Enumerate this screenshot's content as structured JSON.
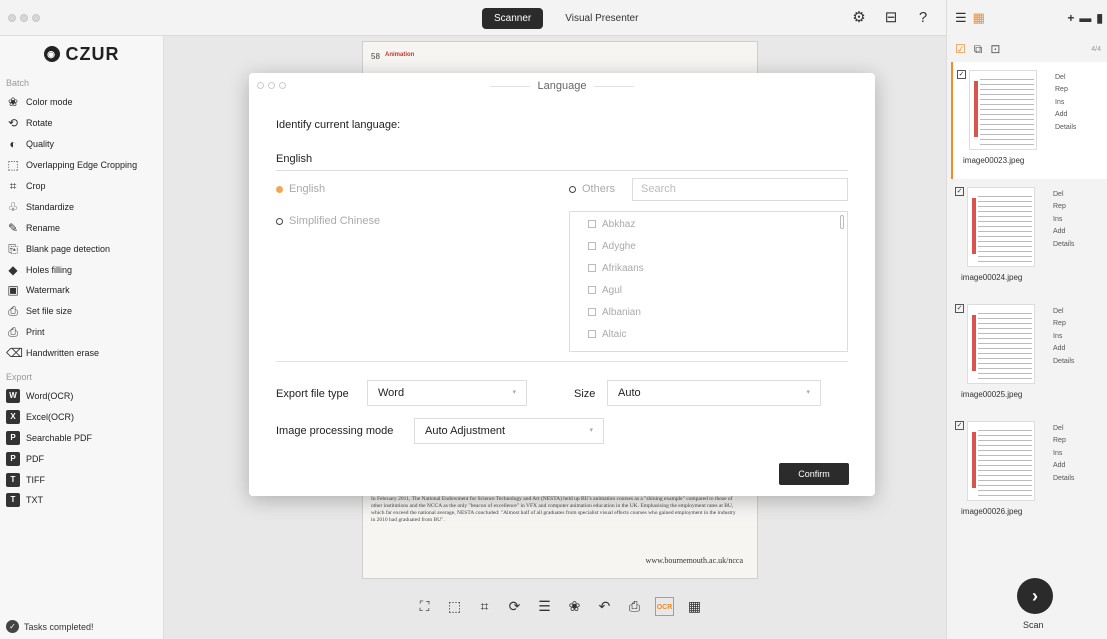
{
  "app": {
    "modes": [
      "Scanner",
      "Visual Presenter"
    ],
    "active_mode": "Scanner",
    "top_icons": [
      "gear-icon",
      "display-icon",
      "help-icon"
    ]
  },
  "sidebar": {
    "logo_text": "CZUR",
    "batch_title": "Batch",
    "batch_items": [
      {
        "label": "Color mode",
        "icon": "color-mode-icon",
        "glyph": "❀"
      },
      {
        "label": "Rotate",
        "icon": "rotate-icon",
        "glyph": "⟲"
      },
      {
        "label": "Quality",
        "icon": "quality-icon",
        "glyph": "◐"
      },
      {
        "label": "Overlapping Edge Cropping",
        "icon": "edge-crop-icon",
        "glyph": "⬚"
      },
      {
        "label": "Crop",
        "icon": "crop-icon",
        "glyph": "⌗"
      },
      {
        "label": "Standardize",
        "icon": "standardize-icon",
        "glyph": "♧"
      },
      {
        "label": "Rename",
        "icon": "rename-icon",
        "glyph": "✎"
      },
      {
        "label": "Blank page detection",
        "icon": "blank-page-icon",
        "glyph": "⎘"
      },
      {
        "label": "Holes filling",
        "icon": "holes-filling-icon",
        "glyph": "◆"
      },
      {
        "label": "Watermark",
        "icon": "watermark-icon",
        "glyph": "▣"
      },
      {
        "label": "Set file size",
        "icon": "file-size-icon",
        "glyph": "⎙"
      },
      {
        "label": "Print",
        "icon": "print-icon",
        "glyph": "⎙"
      },
      {
        "label": "Handwritten erase",
        "icon": "erase-icon",
        "glyph": "⌫"
      }
    ],
    "export_title": "Export",
    "export_items": [
      {
        "label": "Word(OCR)",
        "icon": "word-icon",
        "glyph": "W"
      },
      {
        "label": "Excel(OCR)",
        "icon": "excel-icon",
        "glyph": "X"
      },
      {
        "label": "Searchable PDF",
        "icon": "searchable-pdf-icon",
        "glyph": "P"
      },
      {
        "label": "PDF",
        "icon": "pdf-icon",
        "glyph": "P"
      },
      {
        "label": "TIFF",
        "icon": "tiff-icon",
        "glyph": "T"
      },
      {
        "label": "TXT",
        "icon": "txt-icon",
        "glyph": "T"
      }
    ],
    "status": "Tasks completed!"
  },
  "document": {
    "page_number": "58",
    "heading": "Animation",
    "body_text": "In February 2011, The National Endowment for Science Technology and Art (NESTA) held up BU's animation courses as a \"shining example\" compared to those of other institutions and the NCCA as the only \"beacon of excellence\" in VFX and computer animation education in the UK. Emphasising the employment rates at BU, which far exceed the national average, NESTA concluded: \"Almost half of all graduates from specialist visual effects courses who gained employment in the industry in 2010 had graduated from BU\".",
    "url": "www.bournemouth.ac.uk/ncca"
  },
  "dialog": {
    "title": "Language",
    "identify_label": "Identify current language:",
    "current_language": "English",
    "option_english": "English",
    "option_chinese": "Simplified Chinese",
    "option_others": "Others",
    "search_placeholder": "Search",
    "languages": [
      "Abkhaz",
      "Adyghe",
      "Afrikaans",
      "Agul",
      "Albanian",
      "Altaic"
    ],
    "export_type_label": "Export file type",
    "export_type_value": "Word",
    "size_label": "Size",
    "size_value": "Auto",
    "processing_label": "Image processing mode",
    "processing_value": "Auto Adjustment",
    "confirm_label": "Confirm"
  },
  "right_panel": {
    "page_count": "4/4",
    "thumb_actions": [
      "Del",
      "Rep",
      "Ins",
      "Add",
      "Details"
    ],
    "thumbnails": [
      {
        "name": "image00023.jpeg"
      },
      {
        "name": "image00024.jpeg"
      },
      {
        "name": "image00025.jpeg"
      },
      {
        "name": "image00026.jpeg"
      }
    ],
    "scan_label": "Scan"
  },
  "colors": {
    "accent": "#f28c28",
    "dark": "#2b2b2b"
  }
}
